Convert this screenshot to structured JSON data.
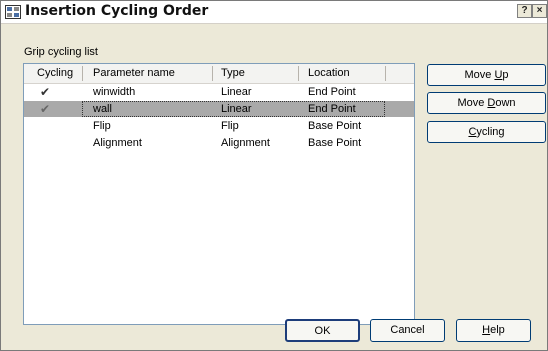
{
  "window": {
    "title": "Insertion Cycling Order",
    "icon": "autocad-icon",
    "help_button": "?",
    "close_button": "×"
  },
  "group_label": "Grip cycling list",
  "list": {
    "columns": [
      "Cycling",
      "Parameter name",
      "Type",
      "Location"
    ],
    "rows": [
      {
        "checked": true,
        "name": "winwidth",
        "type": "Linear",
        "location": "End Point",
        "selected": false
      },
      {
        "checked": true,
        "name": "wall",
        "type": "Linear",
        "location": "End Point",
        "selected": true
      },
      {
        "checked": false,
        "name": "Flip",
        "type": "Flip",
        "location": "Base Point",
        "selected": false
      },
      {
        "checked": false,
        "name": "Alignment",
        "type": "Alignment",
        "location": "Base Point",
        "selected": false
      }
    ]
  },
  "buttons": {
    "move_up": {
      "pre": "Move ",
      "u": "U",
      "post": "p"
    },
    "move_down": {
      "pre": "Move ",
      "u": "D",
      "post": "own"
    },
    "cycling": {
      "pre": "",
      "u": "C",
      "post": "ycling"
    },
    "ok": "OK",
    "cancel": "Cancel",
    "help": {
      "pre": "",
      "u": "H",
      "post": "elp"
    }
  }
}
